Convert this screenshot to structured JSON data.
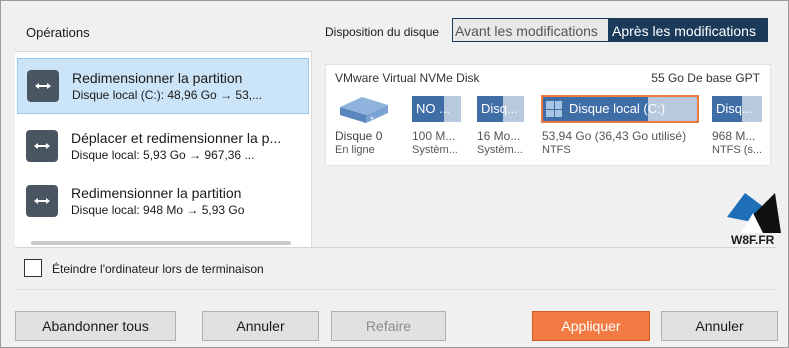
{
  "operations": {
    "title": "Opérations",
    "items": [
      {
        "title": "Redimensionner la partition",
        "detail": "Disque local (C:): 48,96 Go → 53,..."
      },
      {
        "title": "Déplacer et redimensionner la p...",
        "detail": "Disque local: 5,93 Go → 967,36 ..."
      },
      {
        "title": "Redimensionner la partition",
        "detail": "Disque local: 948 Mo → 5,93 Go"
      }
    ]
  },
  "disk_layout": {
    "label": "Disposition du disque",
    "toggle_before": "Avant les modifications",
    "toggle_after": "Après les modifications",
    "disk_name": "VMware Virtual NVMe Disk",
    "disk_info": "55 Go De base GPT",
    "disk_number": "Disque 0",
    "disk_status": "En ligne",
    "partitions": [
      {
        "label": "NO ...",
        "size": "100 M...",
        "fs": "Systèm...",
        "used_fraction": 0.65
      },
      {
        "label": "Disq...",
        "size": "16 Mo...",
        "fs": "Systèm...",
        "used_fraction": 0.55
      },
      {
        "label": "Disque local (C:)",
        "size": "53,94 Go (36,43 Go utilisé)",
        "fs": "NTFS",
        "used_fraction": 0.68
      },
      {
        "label": "Disq...",
        "size": "968 M...",
        "fs": "NTFS (s...",
        "used_fraction": 0.6
      }
    ]
  },
  "watermark": "W8F.FR",
  "shutdown_label": "Éteindre l'ordinateur lors de terminaison",
  "buttons": {
    "abort_all": "Abandonner tous",
    "undo": "Annuler",
    "redo": "Refaire",
    "apply": "Appliquer",
    "cancel": "Annuler"
  },
  "colors": {
    "accent": "#f47a44",
    "partition_used": "#3f6ea6",
    "partition_free": "#b8c9dd",
    "selection": "#cce4f7"
  }
}
